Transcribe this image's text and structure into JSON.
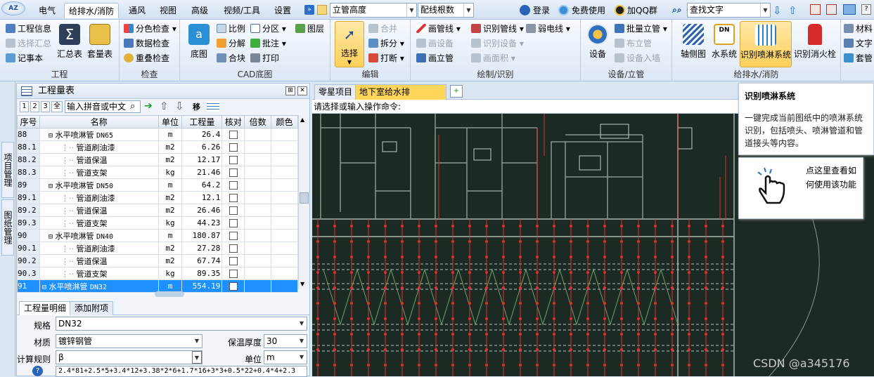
{
  "logo": "AZ",
  "menu": {
    "tabs": [
      "电气",
      "给排水/消防",
      "通风",
      "视图",
      "高级",
      "视频/工具",
      "设置"
    ],
    "active_index": 1,
    "combo_riser": "立管高度",
    "combo_wiring": "配线根数",
    "login": "登录",
    "free_use": "免费使用",
    "qq_group": "加QQ群",
    "find_text": "查找文字"
  },
  "ribbon": {
    "project": {
      "label": "工程",
      "items": [
        "工程信息",
        "选择汇总",
        "记事本"
      ],
      "big": [
        "汇总表",
        "套量表"
      ]
    },
    "check": {
      "label": "检查",
      "items": [
        "分色检查",
        "数据检查",
        "重叠检查"
      ]
    },
    "cad": {
      "label": "CAD底图",
      "big": "底图",
      "items": [
        "比例",
        "分区",
        "图层",
        "分解",
        "批注",
        "合块",
        "打印"
      ]
    },
    "edit": {
      "label": "编辑",
      "big": "选择",
      "items": [
        "合并",
        "拆分",
        "打断"
      ]
    },
    "draw": {
      "label": "绘制/识别",
      "items": [
        "画管线",
        "识别管线",
        "弱电线",
        "画设备",
        "识别设备",
        "画立管",
        "画面积"
      ]
    },
    "device": {
      "label": "设备/立管",
      "big": "设备",
      "items": [
        "批量立管",
        "布立管",
        "设备入墙"
      ]
    },
    "water": {
      "label": "给排水/消防",
      "big": [
        "轴侧图",
        "水系统",
        "识别喷淋系统",
        "识别消火栓"
      ]
    },
    "extra": [
      "材料",
      "文字",
      "套管"
    ]
  },
  "side_tabs": [
    "项目管理",
    "图纸管理"
  ],
  "panel": {
    "title": "工程量表",
    "levels": [
      "1",
      "2",
      "3",
      "全"
    ],
    "search_placeholder": "输入拼音或中文",
    "move_label": "移",
    "columns": [
      "序号",
      "名称",
      "单位",
      "工程量",
      "核对",
      "倍数",
      "颜色"
    ],
    "rows": [
      {
        "no": "88",
        "name": "水平喷淋管",
        "spec": "DN65",
        "unit": "m",
        "qty": "26.4",
        "parent": true
      },
      {
        "no": "88.1",
        "name": "管道刷油漆",
        "spec": "",
        "unit": "m2",
        "qty": "6.26",
        "parent": false
      },
      {
        "no": "88.2",
        "name": "管道保温",
        "spec": "",
        "unit": "m2",
        "qty": "12.17",
        "parent": false
      },
      {
        "no": "88.3",
        "name": "管道支架",
        "spec": "",
        "unit": "kg",
        "qty": "21.46",
        "parent": false
      },
      {
        "no": "89",
        "name": "水平喷淋管",
        "spec": "DN50",
        "unit": "m",
        "qty": "64.2",
        "parent": true
      },
      {
        "no": "89.1",
        "name": "管道刷油漆",
        "spec": "",
        "unit": "m2",
        "qty": "12.1",
        "parent": false
      },
      {
        "no": "89.2",
        "name": "管道保温",
        "spec": "",
        "unit": "m2",
        "qty": "26.46",
        "parent": false
      },
      {
        "no": "89.3",
        "name": "管道支架",
        "spec": "",
        "unit": "kg",
        "qty": "44.23",
        "parent": false
      },
      {
        "no": "90",
        "name": "水平喷淋管",
        "spec": "DN40",
        "unit": "m",
        "qty": "180.87",
        "parent": true
      },
      {
        "no": "90.1",
        "name": "管道刷油漆",
        "spec": "",
        "unit": "m2",
        "qty": "27.28",
        "parent": false
      },
      {
        "no": "90.2",
        "name": "管道保温",
        "spec": "",
        "unit": "m2",
        "qty": "67.74",
        "parent": false
      },
      {
        "no": "90.3",
        "name": "管道支架",
        "spec": "",
        "unit": "kg",
        "qty": "89.35",
        "parent": false
      },
      {
        "no": "91",
        "name": "水平喷淋管",
        "spec": "DN32",
        "unit": "m",
        "qty": "554.19",
        "parent": true,
        "selected": true
      }
    ],
    "bottom_tabs": [
      "工程量明细",
      "添加附项"
    ],
    "detail": {
      "spec_label": "规格",
      "spec_value": "DN32",
      "material_label": "材质",
      "material_value": "镀锌钢管",
      "insulation_label": "保温厚度",
      "insulation_value": "30",
      "rule_label": "计算规则",
      "rule_value": "β",
      "unit_label": "单位",
      "unit_value": "m",
      "formula": "2.4*81+2.5*5+3.4*12+3.38*2*6+1.7*16+3*3+0.5*22+0.4*4+2.3"
    }
  },
  "cad_tabs": [
    "零星项目",
    "地下室给水排水、..."
  ],
  "command_prompt": "请选择或输入操作命令:",
  "tooltip": {
    "title": "识别喷淋系统",
    "body": "一键完成当前图纸中的喷淋系统识别，包括喷头、喷淋管道和管道接头等内容。"
  },
  "help_text": "点这里查看如何使用该功能",
  "watermark": "CSDN @a345176",
  "colors": {
    "accent": "#1e90ff",
    "cad_bg": "#1b2a22",
    "pipe": "#e03030"
  }
}
